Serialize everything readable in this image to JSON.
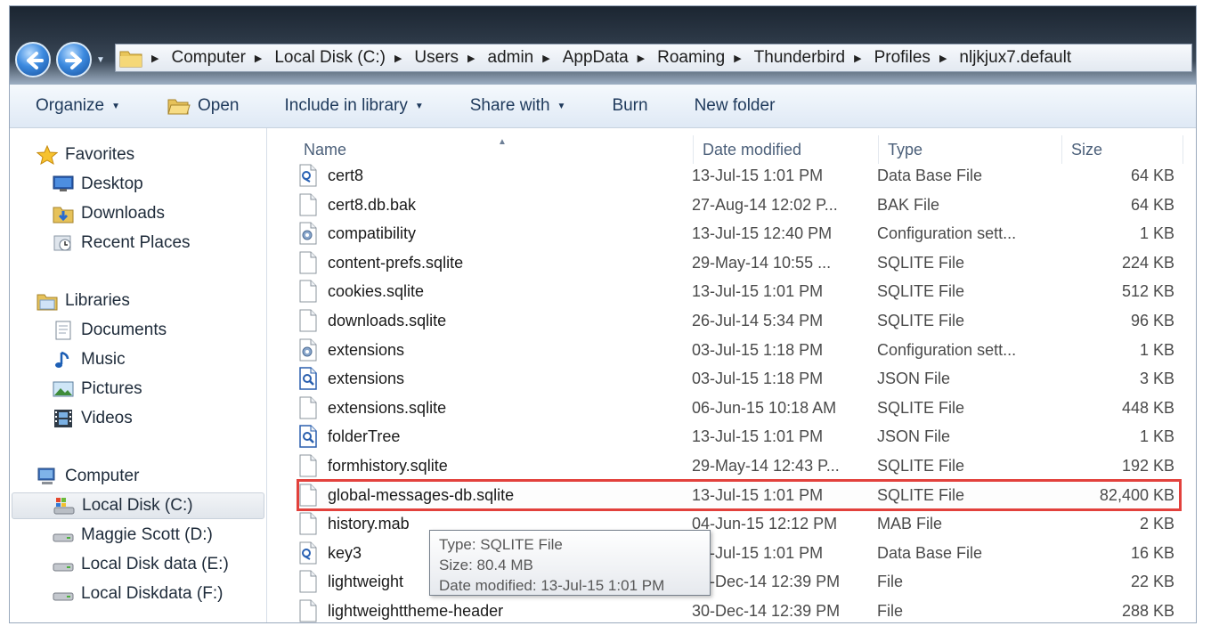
{
  "address": {
    "crumbs": [
      "Computer",
      "Local Disk (C:)",
      "Users",
      "admin",
      "AppData",
      "Roaming",
      "Thunderbird",
      "Profiles",
      "nljkjux7.default"
    ]
  },
  "toolbar": {
    "organize": "Organize",
    "open": "Open",
    "include": "Include in library",
    "share": "Share with",
    "burn": "Burn",
    "new_folder": "New folder"
  },
  "nav": {
    "favorites": "Favorites",
    "desktop": "Desktop",
    "downloads": "Downloads",
    "recent": "Recent Places",
    "libraries": "Libraries",
    "documents": "Documents",
    "music": "Music",
    "pictures": "Pictures",
    "videos": "Videos",
    "computer": "Computer",
    "drive_c": "Local Disk (C:)",
    "drive_d": "Maggie Scott (D:)",
    "drive_e": "Local Disk data (E:)",
    "drive_f": "Local Diskdata (F:)"
  },
  "columns": {
    "name": "Name",
    "date": "Date modified",
    "type": "Type",
    "size": "Size"
  },
  "files": [
    {
      "name": "cert8",
      "date": "13-Jul-15 1:01 PM",
      "type": "Data Base File",
      "size": "64 KB",
      "icon": "db-file-icon"
    },
    {
      "name": "cert8.db.bak",
      "date": "27-Aug-14 12:02 P...",
      "type": "BAK File",
      "size": "64 KB",
      "icon": "blank-file-icon"
    },
    {
      "name": "compatibility",
      "date": "13-Jul-15 12:40 PM",
      "type": "Configuration sett...",
      "size": "1 KB",
      "icon": "config-file-icon"
    },
    {
      "name": "content-prefs.sqlite",
      "date": "29-May-14 10:55 ...",
      "type": "SQLITE File",
      "size": "224 KB",
      "icon": "blank-file-icon"
    },
    {
      "name": "cookies.sqlite",
      "date": "13-Jul-15 1:01 PM",
      "type": "SQLITE File",
      "size": "512 KB",
      "icon": "blank-file-icon"
    },
    {
      "name": "downloads.sqlite",
      "date": "26-Jul-14 5:34 PM",
      "type": "SQLITE File",
      "size": "96 KB",
      "icon": "blank-file-icon"
    },
    {
      "name": "extensions",
      "date": "03-Jul-15 1:18 PM",
      "type": "Configuration sett...",
      "size": "1 KB",
      "icon": "config-file-icon"
    },
    {
      "name": "extensions",
      "date": "03-Jul-15 1:18 PM",
      "type": "JSON File",
      "size": "3 KB",
      "icon": "json-file-icon"
    },
    {
      "name": "extensions.sqlite",
      "date": "06-Jun-15 10:18 AM",
      "type": "SQLITE File",
      "size": "448 KB",
      "icon": "blank-file-icon"
    },
    {
      "name": "folderTree",
      "date": "13-Jul-15 1:01 PM",
      "type": "JSON File",
      "size": "1 KB",
      "icon": "json-file-icon"
    },
    {
      "name": "formhistory.sqlite",
      "date": "29-May-14 12:43 P...",
      "type": "SQLITE File",
      "size": "192 KB",
      "icon": "blank-file-icon"
    },
    {
      "name": "global-messages-db.sqlite",
      "date": "13-Jul-15 1:01 PM",
      "type": "SQLITE File",
      "size": "82,400 KB",
      "icon": "blank-file-icon"
    },
    {
      "name": "history.mab",
      "date": "04-Jun-15 12:12 PM",
      "type": "MAB File",
      "size": "2 KB",
      "icon": "blank-file-icon"
    },
    {
      "name": "key3",
      "date": "13-Jul-15 1:01 PM",
      "type": "Data Base File",
      "size": "16 KB",
      "icon": "db-file-icon"
    },
    {
      "name": "lightweight",
      "date": "30-Dec-14 12:39 PM",
      "type": "File",
      "size": "22 KB",
      "icon": "blank-file-icon"
    },
    {
      "name": "lightweighttheme-header",
      "date": "30-Dec-14 12:39 PM",
      "type": "File",
      "size": "288 KB",
      "icon": "blank-file-icon"
    }
  ],
  "tooltip": {
    "type": "Type: SQLITE File",
    "size": "Size: 80.4 MB",
    "date": "Date modified: 13-Jul-15 1:01 PM"
  },
  "colors": {
    "highlight": "#e2413c",
    "toolbar_text": "#1e395b"
  }
}
